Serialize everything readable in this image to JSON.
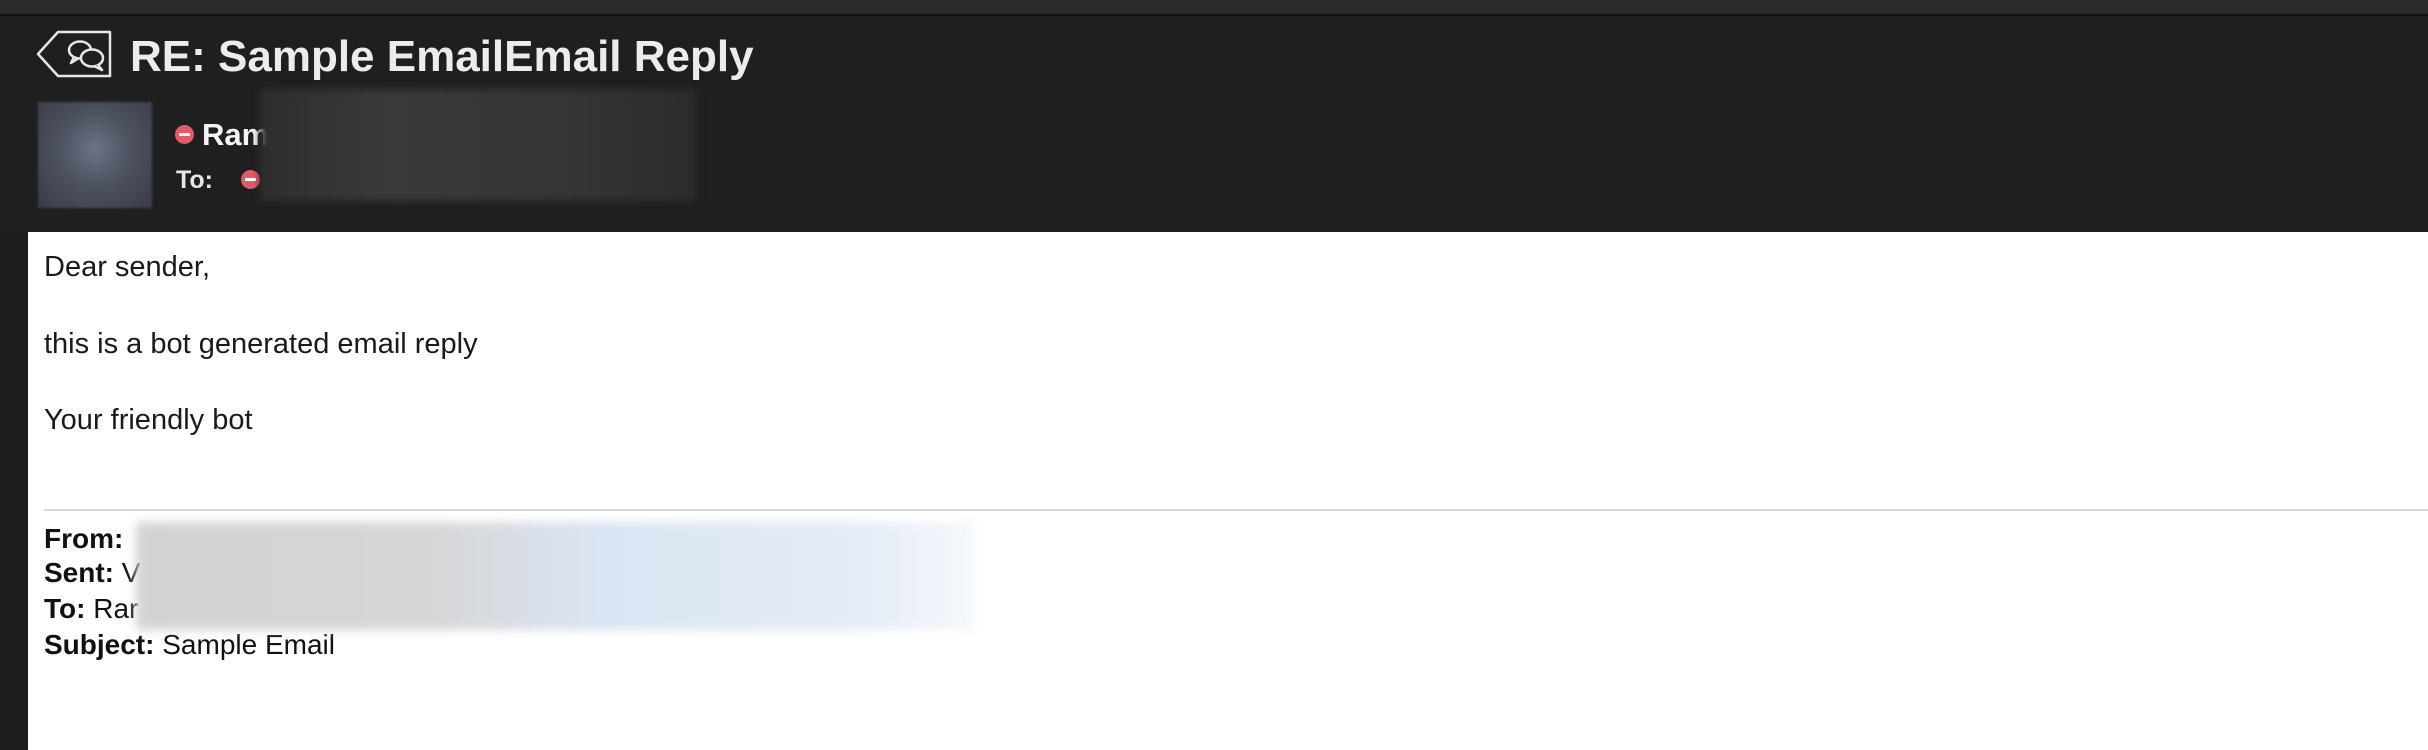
{
  "header": {
    "subject": "RE: Sample EmailEmail Reply",
    "sender_name": "Ram",
    "to_label": "To:",
    "reply_icon": "reply-all-icon"
  },
  "body": {
    "greeting": "Dear sender,",
    "message": "this is a bot generated email reply",
    "signature": "Your friendly bot"
  },
  "quoted": {
    "from_label": "From:",
    "from_value": "",
    "sent_label": "Sent:",
    "sent_value": "V",
    "to_label": "To:",
    "to_value": "Rar",
    "subject_label": "Subject:",
    "subject_value": "Sample Email"
  },
  "colors": {
    "header_bg": "#1f1f1f",
    "status_dot": "#e35a68",
    "content_bg": "#ffffff"
  }
}
